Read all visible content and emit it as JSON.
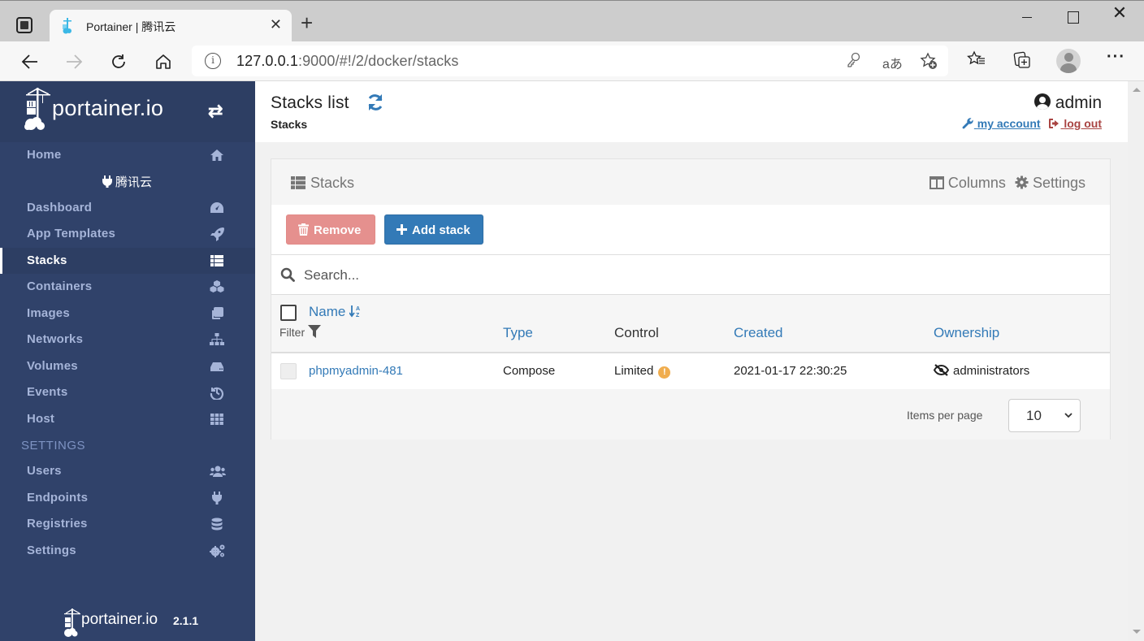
{
  "browser": {
    "tab_title": "Portainer | 腾讯云",
    "url_host": "127.0.0.1",
    "url_rest": ":9000/#!/2/docker/stacks",
    "icons": [
      "tab-actions-icon",
      "back-icon",
      "forward-icon",
      "reload-icon",
      "home-icon",
      "info-icon",
      "key-icon",
      "read-aloud-icon",
      "add-favorite-icon",
      "favorites-icon",
      "collections-icon",
      "profile-icon",
      "more-icon"
    ]
  },
  "sidebar": {
    "logo_text": "portainer.io",
    "endpoint_name": "腾讯云",
    "home_label": "Home",
    "items": [
      {
        "label": "Dashboard",
        "icon": "dashboard-icon"
      },
      {
        "label": "App Templates",
        "icon": "rocket-icon"
      },
      {
        "label": "Stacks",
        "icon": "list-icon",
        "active": true
      },
      {
        "label": "Containers",
        "icon": "cubes-icon"
      },
      {
        "label": "Images",
        "icon": "clone-icon"
      },
      {
        "label": "Networks",
        "icon": "sitemap-icon"
      },
      {
        "label": "Volumes",
        "icon": "hdd-icon"
      },
      {
        "label": "Events",
        "icon": "history-icon"
      },
      {
        "label": "Host",
        "icon": "th-icon"
      }
    ],
    "settings_section": "SETTINGS",
    "settings_items": [
      {
        "label": "Users",
        "icon": "users-icon"
      },
      {
        "label": "Endpoints",
        "icon": "plug-icon"
      },
      {
        "label": "Registries",
        "icon": "database-icon"
      },
      {
        "label": "Settings",
        "icon": "cogs-icon"
      }
    ],
    "footer_logo_text": "portainer.io",
    "version": "2.1.1"
  },
  "header": {
    "title": "Stacks list",
    "breadcrumb": "Stacks",
    "username": "admin",
    "my_account": "my account",
    "log_out": "log out"
  },
  "widget": {
    "title": "Stacks",
    "columns_label": "Columns",
    "settings_label": "Settings",
    "remove_label": "Remove",
    "add_label": "Add stack",
    "search_placeholder": "Search...",
    "filter_label": "Filter",
    "columns": [
      "Name",
      "Type",
      "Control",
      "Created",
      "Ownership"
    ],
    "rows": [
      {
        "name": "phpmyadmin-481",
        "type": "Compose",
        "control": "Limited",
        "created": "2021-01-17 22:30:25",
        "ownership": "administrators"
      }
    ],
    "items_per_page_label": "Items per page",
    "items_per_page": "10"
  },
  "colors": {
    "sidebar_bg": "#30426a",
    "accent": "#337ab7",
    "danger": "#e5908e",
    "warning": "#f0ad4e",
    "logout": "#a94442"
  }
}
